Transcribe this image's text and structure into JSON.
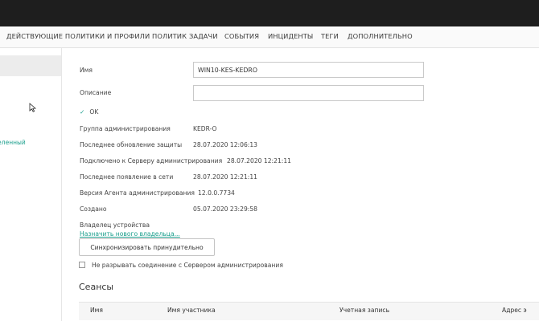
{
  "nav": {
    "items": [
      "ДЕЙСТВУЮЩИЕ ПОЛИТИКИ И ПРОФИЛИ ПОЛИТИК",
      "ЗАДАЧИ",
      "СОБЫТИЯ",
      "ИНЦИДЕНТЫ",
      "ТЕГИ",
      "ДОПОЛНИТЕЛЬНО"
    ]
  },
  "sidebar": {
    "link_text": "деленный"
  },
  "form": {
    "name_label": "Имя",
    "name_value": "WIN10-KES-KEDRO",
    "description_label": "Описание",
    "description_value": "",
    "status": "OK"
  },
  "details": [
    {
      "label": "Группа администрирования",
      "value": "KEDR-O"
    },
    {
      "label": "Последнее обновление защиты",
      "value": "28.07.2020 12:06:13"
    },
    {
      "label": "Подключено к Серверу администрирования",
      "value": "28.07.2020 12:21:11"
    },
    {
      "label": "Последнее появление в сети",
      "value": "28.07.2020 12:21:11"
    },
    {
      "label": "Версия Агента администрирования",
      "value": "12.0.0.7734"
    },
    {
      "label": "Создано",
      "value": "05.07.2020 23:29:58"
    }
  ],
  "owner": {
    "label": "Владелец устройства",
    "assign_link": "Назначить нового владельца..."
  },
  "sync_button": "Синхронизировать принудительно",
  "keep_connection": {
    "label": "Не разрывать соединение с Сервером администрирования",
    "checked": false
  },
  "sessions": {
    "title": "Сеансы",
    "columns": [
      "Имя",
      "Имя участника",
      "Учетная запись",
      "Адрес э"
    ]
  },
  "colors": {
    "accent": "#1a9e8c",
    "topbar": "#1e1e1e"
  }
}
